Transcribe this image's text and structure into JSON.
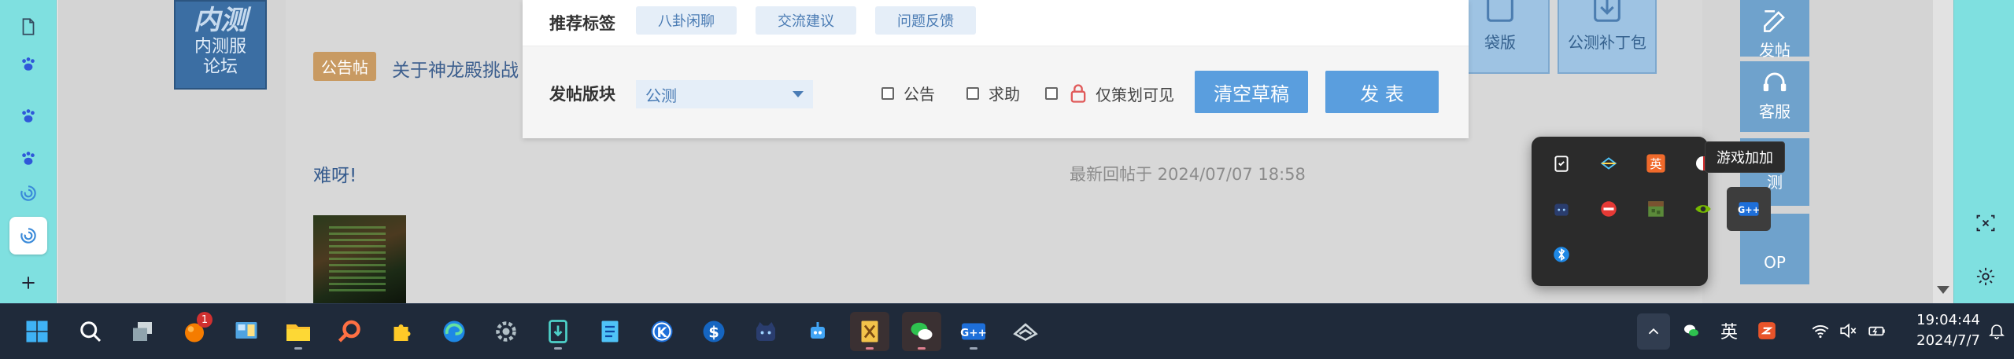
{
  "page": {
    "beta_logo": {
      "big": "内测",
      "line1": "内测服",
      "line2": "论坛"
    },
    "notice_badge": "公告帖",
    "notice_title": "关于神龙殿挑战",
    "thread_title": "难呀!",
    "last_reply": "最新回帖于  2024/07/07  18:58",
    "side_buttons": [
      {
        "label": "袋版"
      },
      {
        "label": "公测补丁包"
      }
    ],
    "right_tools": [
      {
        "label": "发帖"
      },
      {
        "label": "客服"
      },
      {
        "label": "测"
      },
      {
        "label": "OP"
      }
    ]
  },
  "editor": {
    "tags_label": "推荐标签",
    "tags": [
      "八卦闲聊",
      "交流建议",
      "问题反馈"
    ],
    "board_label": "发帖版块",
    "board_value": "公测",
    "checkboxes": [
      "公告",
      "求助",
      "仅策划可见"
    ],
    "clear_button": "清空草稿",
    "publish_button": "发 表"
  },
  "tray_popup": {
    "tooltip": "游戏加加",
    "icons": [
      "clipboard-icon",
      "feather-icon",
      "ime-ying-icon",
      "red-white-icon",
      "cat-icon",
      "red-stop-icon",
      "minecraft-icon",
      "nvidia-icon",
      "gplus-icon",
      "bluetooth-icon"
    ]
  },
  "taskbar": {
    "badge_count": "1",
    "ime_label": "英",
    "time": "19:04:44",
    "date": "2024/7/7"
  },
  "colors": {
    "sidebar": "#7fe0e0",
    "taskbar": "#1f2a3a",
    "accent_button": "#5a9ede",
    "tag_bg": "#e5eef8"
  }
}
